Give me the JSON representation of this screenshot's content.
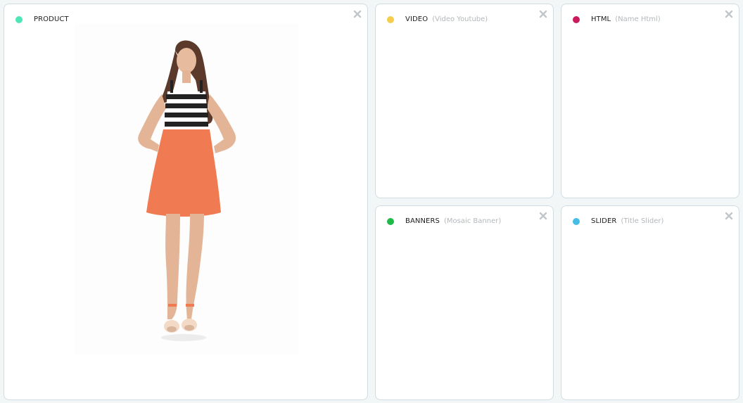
{
  "cards": {
    "product": {
      "title": "PRODUCT",
      "subtitle": "",
      "dot_color": "#4de6b7"
    },
    "video": {
      "title": "VIDEO",
      "subtitle": "(Video Youtube)",
      "dot_color": "#f5cd4b"
    },
    "html": {
      "title": "HTML",
      "subtitle": "(Name Html)",
      "dot_color": "#cc1a5c"
    },
    "banners": {
      "title": "BANNERS",
      "subtitle": "(Mosaic Banner)",
      "dot_color": "#1fba4a"
    },
    "slider": {
      "title": "SLIDER",
      "subtitle": "(Title Slider)",
      "dot_color": "#46bde7"
    }
  },
  "icons": {
    "close": "close-icon"
  },
  "product_image": {
    "description_icon": "product-photo",
    "top_color": "#222222",
    "skirt_color": "#f07a52",
    "skin_color": "#e3b596",
    "hair_color": "#5b3a2c"
  }
}
